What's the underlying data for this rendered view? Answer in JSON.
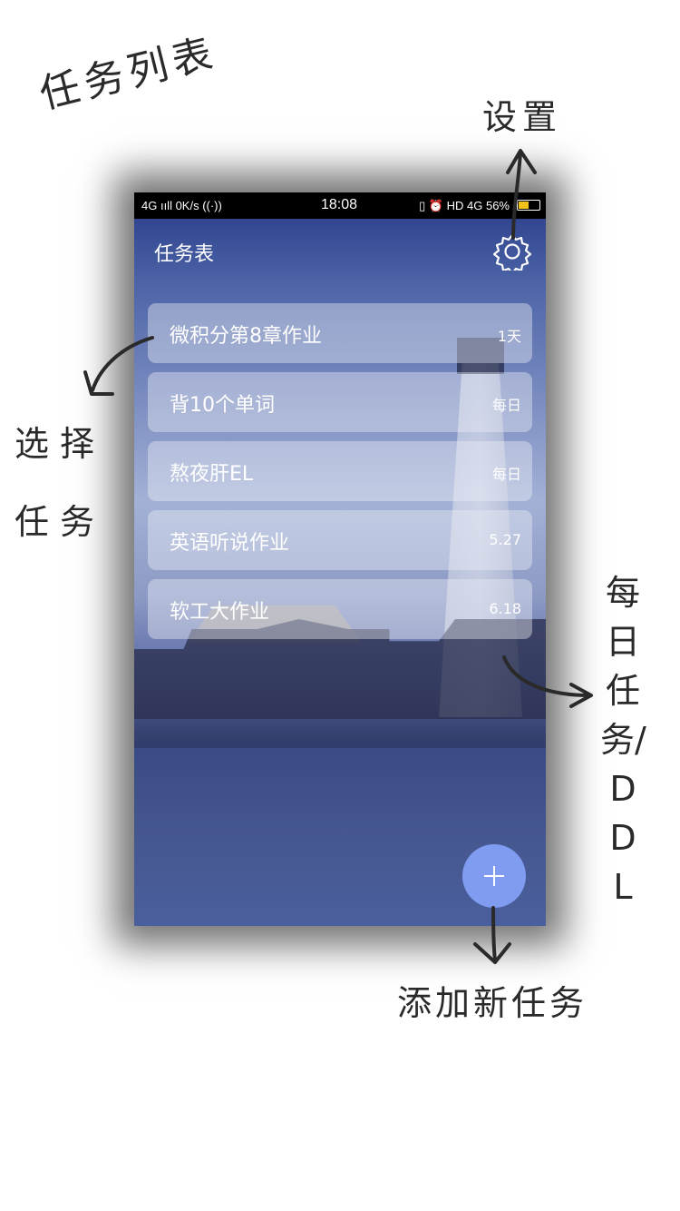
{
  "annotations": {
    "title": "任务列表",
    "settings": "设置",
    "select_line1": "选择",
    "select_line2": "任务",
    "daily": "每日任务/DDL",
    "add": "添加新任务"
  },
  "statusbar": {
    "left": "4G ııll  0K/s ((·))",
    "time": "18:08",
    "right": "▯ ⏰ HD 4G 56%",
    "battery_percent": 56,
    "battery_color": "#f2c21b"
  },
  "header": {
    "title": "任务表",
    "settings_icon": "gear-icon"
  },
  "tasks": [
    {
      "name": "微积分第8章作业",
      "due": "1天"
    },
    {
      "name": "背10个单词",
      "due": "每日"
    },
    {
      "name": "熬夜肝EL",
      "due": "每日"
    },
    {
      "name": "英语听说作业",
      "due": "5.27"
    },
    {
      "name": "软工大作业",
      "due": "6.18"
    }
  ],
  "fab": {
    "icon": "plus-icon",
    "color": "#7f9cf0"
  }
}
